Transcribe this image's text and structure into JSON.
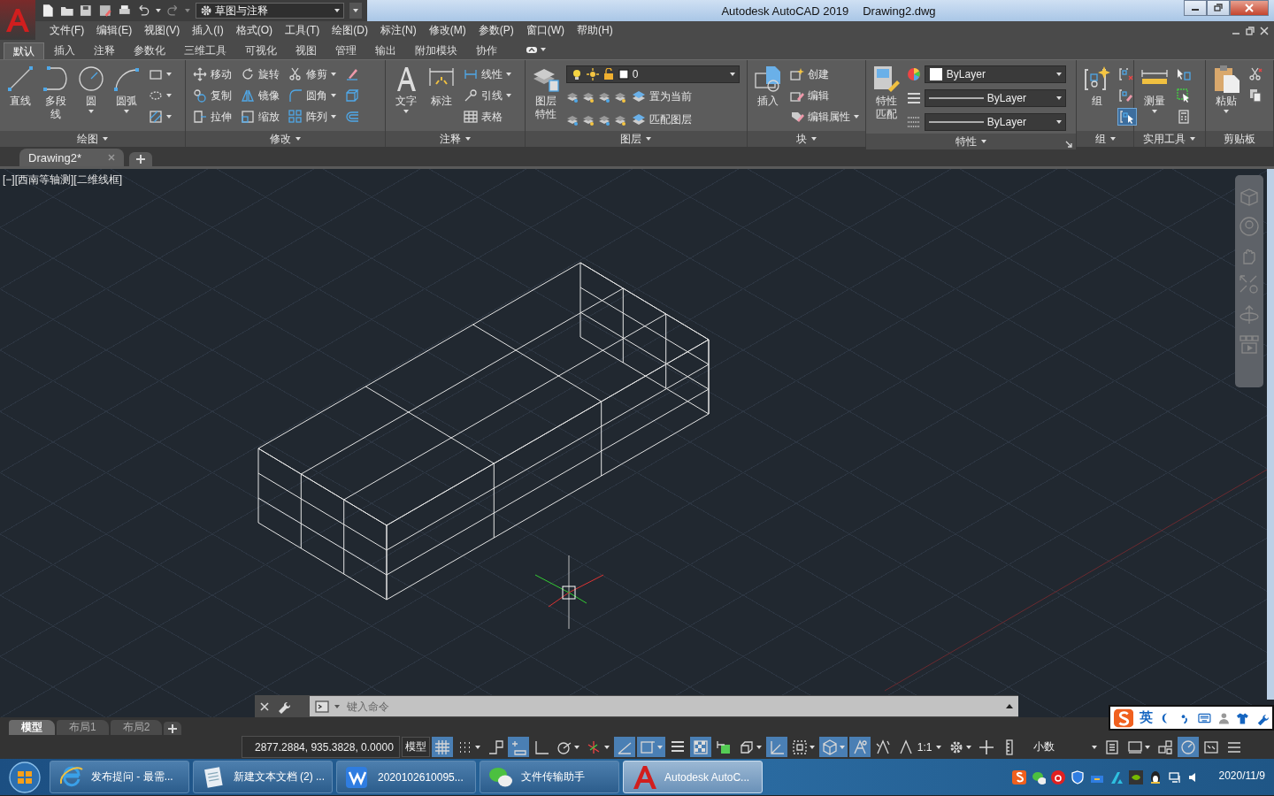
{
  "title_bar": {
    "workspace": "草图与注释",
    "title": "Autodesk AutoCAD 2019",
    "file": "Drawing2.dwg"
  },
  "menu_bar": [
    "文件(F)",
    "编辑(E)",
    "视图(V)",
    "插入(I)",
    "格式(O)",
    "工具(T)",
    "绘图(D)",
    "标注(N)",
    "修改(M)",
    "参数(P)",
    "窗口(W)",
    "帮助(H)"
  ],
  "ribbon_tabs": [
    {
      "label": "默认",
      "selected": true
    },
    {
      "label": "插入",
      "selected": false
    },
    {
      "label": "注释",
      "selected": false
    },
    {
      "label": "参数化",
      "selected": false
    },
    {
      "label": "三维工具",
      "selected": false
    },
    {
      "label": "可视化",
      "selected": false
    },
    {
      "label": "视图",
      "selected": false
    },
    {
      "label": "管理",
      "selected": false
    },
    {
      "label": "输出",
      "selected": false
    },
    {
      "label": "附加模块",
      "selected": false
    },
    {
      "label": "协作",
      "selected": false
    }
  ],
  "ribbon_panels": [
    {
      "title": "绘图",
      "menu": true,
      "columns": [
        {
          "kind": "large",
          "label": "直线",
          "dropdown": false
        },
        {
          "kind": "large",
          "label": "多段线",
          "dropdown": false
        },
        {
          "kind": "large",
          "label": "圆",
          "dropdown": true
        },
        {
          "kind": "large",
          "label": "圆弧",
          "dropdown": true
        },
        {
          "kind": "stack",
          "items": [
            {
              "dropdown": true
            },
            {
              "dropdown": true
            },
            {
              "dropdown": true
            }
          ]
        }
      ]
    },
    {
      "title": "修改",
      "menu": true,
      "columns": [
        {
          "kind": "stack",
          "items": [
            {
              "label": "移动",
              "dropdown": false
            },
            {
              "label": "复制",
              "dropdown": false
            },
            {
              "label": "拉伸",
              "dropdown": false
            }
          ]
        },
        {
          "kind": "stack",
          "items": [
            {
              "label": "旋转",
              "dropdown": false
            },
            {
              "label": "镜像",
              "dropdown": false
            },
            {
              "label": "缩放",
              "dropdown": false
            }
          ]
        },
        {
          "kind": "stack",
          "items": [
            {
              "label": "修剪",
              "dropdown": true
            },
            {
              "label": "圆角",
              "dropdown": true
            },
            {
              "label": "阵列",
              "dropdown": true
            }
          ]
        },
        {
          "kind": "stack",
          "items": [
            {
              "dropdown": false
            },
            {
              "dropdown": false
            },
            {
              "dropdown": false
            }
          ]
        }
      ]
    },
    {
      "title": "注释",
      "menu": true,
      "columns": [
        {
          "kind": "large",
          "label": "文字",
          "dropdown": true
        },
        {
          "kind": "large",
          "label": "标注",
          "dropdown": false
        },
        {
          "kind": "stack",
          "items": [
            {
              "label": "线性",
              "dropdown": true
            },
            {
              "label": "引线",
              "dropdown": true
            },
            {
              "label": "表格",
              "dropdown": false
            }
          ]
        }
      ]
    },
    {
      "title": "图层",
      "menu": true,
      "columns": [
        {
          "kind": "large",
          "label": "图层特性",
          "dropdown": false
        },
        {
          "kind": "layers",
          "value": "0",
          "items": [
            {
              "label": "置为当前",
              "dropdown": false
            },
            {
              "label": "匹配图层",
              "dropdown": false
            }
          ]
        }
      ]
    },
    {
      "title": "块",
      "menu": true,
      "columns": [
        {
          "kind": "large",
          "label": "插入",
          "dropdown": false
        },
        {
          "kind": "stack",
          "items": [
            {
              "label": "创建",
              "dropdown": false
            },
            {
              "label": "编辑",
              "dropdown": false
            },
            {
              "label": "编辑属性",
              "dropdown": true
            }
          ]
        }
      ]
    },
    {
      "title": "特性",
      "menu": true,
      "columns": [
        {
          "kind": "large",
          "label": "特性匹配",
          "dropdown": false
        },
        {
          "kind": "combos",
          "items": [
            {
              "kind": "color",
              "value": "ByLayer"
            },
            {
              "kind": "linetype",
              "value": "ByLayer"
            },
            {
              "kind": "lineweight",
              "value": "ByLayer"
            }
          ]
        }
      ]
    },
    {
      "title": "组",
      "menu": true,
      "columns": [
        {
          "kind": "large",
          "label": "组",
          "dropdown": false
        },
        {
          "kind": "stack",
          "items": [
            {
              "dropdown": false,
              "on": false
            },
            {
              "dropdown": false,
              "on": false
            },
            {
              "dropdown": false,
              "on": true
            }
          ]
        }
      ]
    },
    {
      "title": "实用工具",
      "menu": true,
      "columns": [
        {
          "kind": "large",
          "label": "测量",
          "dropdown": true
        },
        {
          "kind": "stack",
          "items": [
            {
              "dropdown": false
            },
            {
              "dropdown": false
            },
            {
              "dropdown": false
            }
          ]
        }
      ]
    },
    {
      "title": "剪贴板",
      "menu": false,
      "columns": [
        {
          "kind": "large",
          "label": "粘贴",
          "dropdown": true
        },
        {
          "kind": "stack",
          "items": [
            {
              "dropdown": false
            },
            {
              "dropdown": false
            }
          ]
        }
      ]
    }
  ],
  "doc_tabs": [
    {
      "label": "Drawing2*",
      "selected": true
    }
  ],
  "viewport": {
    "label": "[−][西南等轴测][二维线框]"
  },
  "command_line": {
    "placeholder": "键入命令"
  },
  "layout_tabs": [
    {
      "label": "模型",
      "selected": true
    },
    {
      "label": "布局1",
      "selected": false
    },
    {
      "label": "布局2",
      "selected": false
    }
  ],
  "status_bar": {
    "coordinates": "2877.2884, 935.3828, 0.0000",
    "space": "模型",
    "tools": [
      {
        "on": true,
        "dropdown": false
      },
      {
        "on": false,
        "dropdown": true
      },
      {
        "on": false,
        "dropdown": false
      },
      {
        "on": true,
        "dropdown": false
      },
      {
        "on": false,
        "dropdown": false
      },
      {
        "on": false,
        "dropdown": true
      },
      {
        "on": false,
        "dropdown": true
      },
      {
        "on": true,
        "dropdown": false
      },
      {
        "on": true,
        "dropdown": true
      },
      {
        "on": false,
        "dropdown": false
      },
      {
        "on": true,
        "dropdown": false
      },
      {
        "on": false,
        "dropdown": false
      },
      {
        "on": false,
        "dropdown": true
      },
      {
        "on": true,
        "dropdown": false
      },
      {
        "on": false,
        "dropdown": true
      },
      {
        "on": true,
        "dropdown": true
      },
      {
        "on": true,
        "dropdown": false
      },
      {
        "on": false,
        "dropdown": false
      },
      {
        "on": false,
        "dropdown": true,
        "label": "1:1"
      },
      {
        "on": false,
        "dropdown": true
      },
      {
        "on": false,
        "dropdown": false
      },
      {
        "on": false,
        "dropdown": true,
        "label": "小数"
      },
      {
        "on": false,
        "dropdown": false
      },
      {
        "on": false,
        "dropdown": true
      },
      {
        "on": false,
        "dropdown": false
      },
      {
        "on": true,
        "dropdown": false
      },
      {
        "on": false,
        "dropdown": false
      },
      {
        "on": false,
        "dropdown": false
      }
    ]
  },
  "ime_bar": {
    "mode": "英"
  },
  "taskbar": {
    "tasks": [
      {
        "label": "发布提问 - 最需...",
        "selected": false
      },
      {
        "label": "新建文本文档 (2) ...",
        "selected": false
      },
      {
        "label": "2020102610095...",
        "selected": false
      },
      {
        "label": "文件传输助手",
        "selected": false
      },
      {
        "label": "Autodesk AutoC...",
        "selected": true
      }
    ],
    "date": "2020/11/9"
  }
}
